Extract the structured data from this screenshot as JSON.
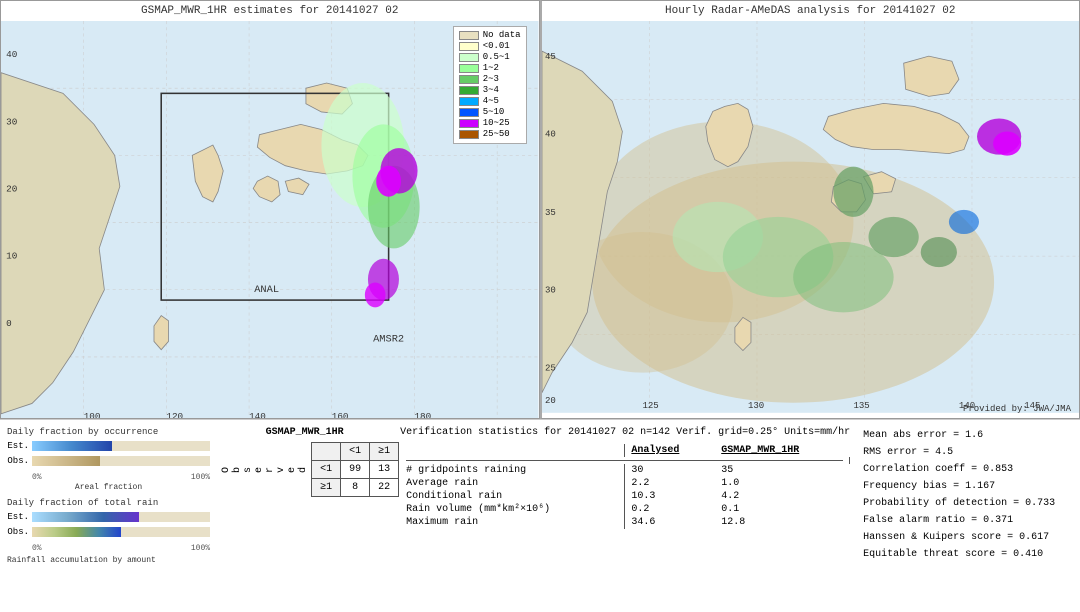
{
  "left_map": {
    "title": "GSMAP_MWR_1HR estimates for 20141027 02",
    "label_anal": "ANAL",
    "label_amsr2": "AMSR2"
  },
  "right_map": {
    "title": "Hourly Radar-AMeDAS analysis for 20141027 02",
    "credit": "Provided by: JWA/JMA"
  },
  "legend": {
    "title": "No data",
    "items": [
      {
        "label": "No data",
        "color": "#e8e0c0"
      },
      {
        "label": "<0.01",
        "color": "#ffffcc"
      },
      {
        "label": "0.5~1",
        "color": "#ccffcc"
      },
      {
        "label": "1~2",
        "color": "#99ff99"
      },
      {
        "label": "2~3",
        "color": "#66cc66"
      },
      {
        "label": "3~4",
        "color": "#33aa33"
      },
      {
        "label": "4~5",
        "color": "#00aaff"
      },
      {
        "label": "5~10",
        "color": "#0055ff"
      },
      {
        "label": "10~25",
        "color": "#cc00ff"
      },
      {
        "label": "25~50",
        "color": "#aa5500"
      }
    ]
  },
  "charts": {
    "title1": "Daily fraction by occurrence",
    "title2": "Daily fraction of total rain",
    "title3": "Rainfall accumulation by amount",
    "est_label": "Est.",
    "obs_label": "Obs.",
    "axis_0": "0%",
    "axis_100": "100%",
    "axis_label": "Areal fraction"
  },
  "contingency": {
    "title": "GSMAP_MWR_1HR",
    "col1": "<1",
    "col2": "≥1",
    "row1": "<1",
    "row2": "≥1",
    "v_99": "99",
    "v_13": "13",
    "v_8": "8",
    "v_22": "22",
    "observed_label": "O\nb\ns\ne\nr\nv\ne\nd"
  },
  "verification": {
    "title": "Verification statistics for 20141027 02  n=142  Verif. grid=0.25°  Units=mm/hr",
    "col_analysed": "Analysed",
    "col_gsmap": "GSMAP_MWR_1HR",
    "row1_label": "# gridpoints raining",
    "row1_val1": "30",
    "row1_val2": "35",
    "row2_label": "Average rain",
    "row2_val1": "2.2",
    "row2_val2": "1.0",
    "row3_label": "Conditional rain",
    "row3_val1": "10.3",
    "row3_val2": "4.2",
    "row4_label": "Rain volume (mm*km²×10⁶)",
    "row4_val1": "0.2",
    "row4_val2": "0.1",
    "row5_label": "Maximum rain",
    "row5_val1": "34.6",
    "row5_val2": "12.8"
  },
  "stats_right": {
    "mean_abs_error": "Mean abs error = 1.6",
    "rms_error": "RMS error = 4.5",
    "corr_coeff": "Correlation coeff = 0.853",
    "freq_bias": "Frequency bias = 1.167",
    "prob_detection": "Probability of detection = 0.733",
    "false_alarm": "False alarm ratio = 0.371",
    "hanssen": "Hanssen & Kuipers score = 0.617",
    "equitable": "Equitable threat score = 0.410"
  }
}
